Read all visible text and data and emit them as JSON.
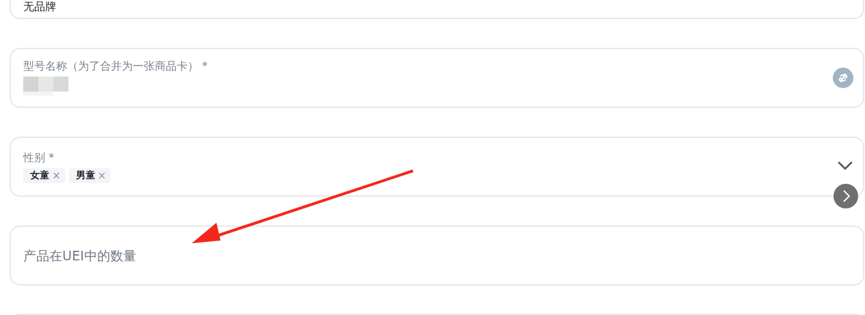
{
  "fields": [
    {
      "kind": "text",
      "value": "无品牌"
    },
    {
      "kind": "text",
      "label": "型号名称（为了合并为一张商品卡）",
      "required_mark": "*",
      "redacted": true,
      "link_icon": true
    },
    {
      "kind": "select",
      "label": "性别",
      "required_mark": "*",
      "tags": [
        {
          "label": "女童",
          "remove": "×"
        },
        {
          "label": "男童",
          "remove": "×"
        }
      ]
    },
    {
      "kind": "text",
      "placeholder": "产品在UEI中的数量"
    }
  ]
}
